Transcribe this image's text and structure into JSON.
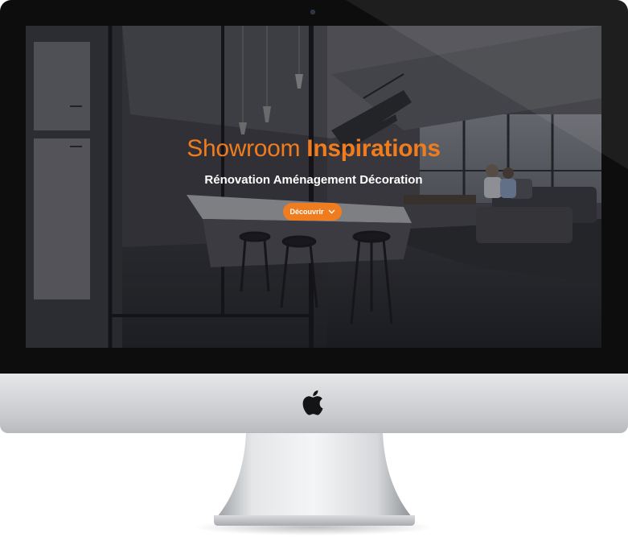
{
  "hero": {
    "title_light": "Showroom",
    "title_bold": "Inspirations",
    "subtitle": "Rénovation Aménagement Décoration",
    "cta_label": "Découvrir",
    "cta_icon": "chevron-down-icon"
  },
  "colors": {
    "accent": "#ef7c1f",
    "subtitle": "#ffffff",
    "bezel": "#0d0d0e",
    "chin": "#d3d5d8"
  },
  "device": {
    "logo_icon": "apple-logo-icon"
  }
}
